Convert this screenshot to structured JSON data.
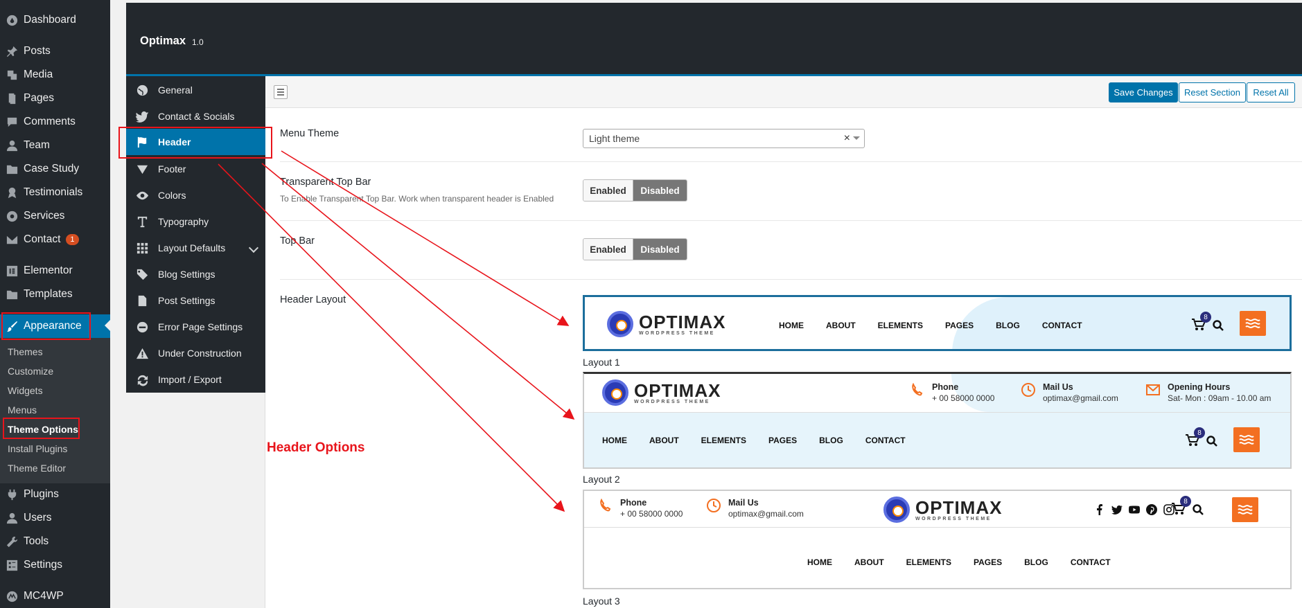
{
  "wp_menu": {
    "dashboard": "Dashboard",
    "posts": "Posts",
    "media": "Media",
    "pages": "Pages",
    "comments": "Comments",
    "team": "Team",
    "case_study": "Case Study",
    "testimonials": "Testimonials",
    "services": "Services",
    "contact": "Contact",
    "contact_badge": "1",
    "elementor": "Elementor",
    "templates": "Templates",
    "appearance": "Appearance",
    "plugins": "Plugins",
    "users": "Users",
    "tools": "Tools",
    "settings": "Settings",
    "mc4wp": "MC4WP"
  },
  "appearance_submenu": {
    "themes": "Themes",
    "customize": "Customize",
    "widgets": "Widgets",
    "menus": "Menus",
    "theme_options": "Theme Options",
    "install_plugins": "Install Plugins",
    "theme_editor": "Theme Editor"
  },
  "options_panel": {
    "title": "Optimax",
    "version": "1.0"
  },
  "options_menu": {
    "general": "General",
    "contact_socials": "Contact & Socials",
    "header": "Header",
    "footer": "Footer",
    "colors": "Colors",
    "typography": "Typography",
    "layout_defaults": "Layout Defaults",
    "blog_settings": "Blog Settings",
    "post_settings": "Post Settings",
    "error_page_settings": "Error Page Settings",
    "under_construction": "Under Construction",
    "import_export": "Import / Export"
  },
  "toolbar": {
    "save_label": "Save Changes",
    "reset_section_label": "Reset Section",
    "reset_all_label": "Reset All"
  },
  "fields": {
    "menu_theme": {
      "label": "Menu Theme",
      "value": "Light theme"
    },
    "transparent_top_bar": {
      "label": "Transparent Top Bar",
      "description": "To Enable Transparent Top Bar. Work when transparent header is Enabled",
      "on_label": "Enabled",
      "off_label": "Disabled"
    },
    "top_bar": {
      "label": "Top Bar",
      "on_label": "Enabled",
      "off_label": "Disabled"
    },
    "header_layout": {
      "label": "Header Layout"
    }
  },
  "preview": {
    "logo_name": "OPTIMAX",
    "logo_tag": "WORDPRESS THEME",
    "nav": [
      "HOME",
      "ABOUT",
      "ELEMENTS",
      "PAGES",
      "BLOG",
      "CONTACT"
    ],
    "cart_count": "8",
    "phone_title": "Phone",
    "phone_value": "+ 00 58000 0000",
    "mail_title": "Mail Us",
    "mail_value": "optimax@gmail.com",
    "hours_title": "Opening Hours",
    "hours_value": "Sat- Mon : 09am - 10.00 am"
  },
  "layouts": {
    "layout1": "Layout 1",
    "layout2": "Layout 2",
    "layout3": "Layout 3"
  },
  "annotation": {
    "header_options": "Header Options",
    "color": "#e8141b"
  },
  "colors": {
    "wp_dark": "#23282d",
    "wp_blue": "#0073aa",
    "accent_orange": "#f36f21"
  }
}
